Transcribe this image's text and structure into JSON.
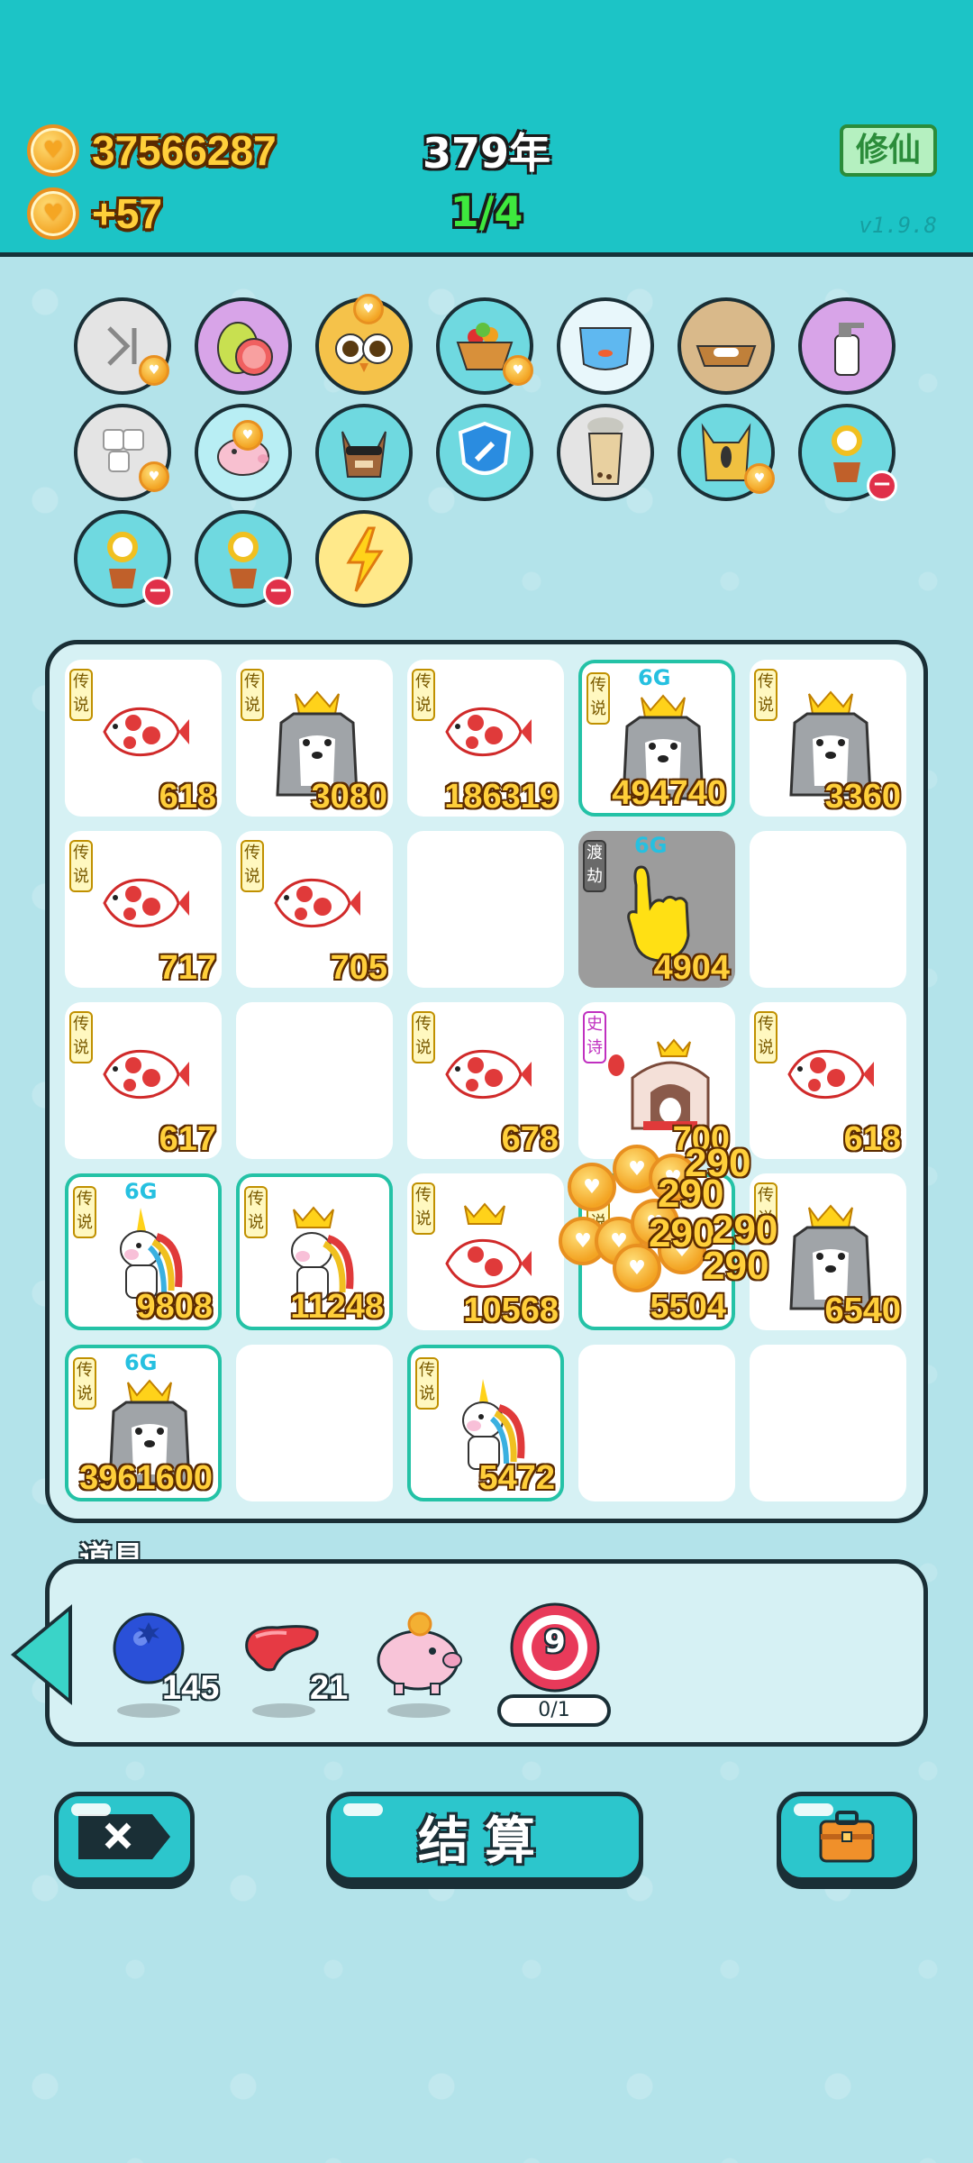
{
  "header": {
    "coins": "37566287",
    "income": "+57",
    "year": "379年",
    "round": "1/4",
    "cultivate_label": "修仙",
    "version": "v1.9.8"
  },
  "item_icons": [
    {
      "name": "skip-icon"
    },
    {
      "name": "pomelo-icon"
    },
    {
      "name": "owl-icon"
    },
    {
      "name": "fruit-basket-icon"
    },
    {
      "name": "fishbowl-icon"
    },
    {
      "name": "pet-food-icon"
    },
    {
      "name": "spray-bottle-icon"
    },
    {
      "name": "dice-icon"
    },
    {
      "name": "piggy-bank-icon"
    },
    {
      "name": "cool-dog-icon"
    },
    {
      "name": "shield-wrench-icon"
    },
    {
      "name": "bubble-tea-icon"
    },
    {
      "name": "cat-icon"
    },
    {
      "name": "flower-pot-icon"
    },
    {
      "name": "flower-pot-icon"
    },
    {
      "name": "flower-pot-icon"
    },
    {
      "name": "lightning-icon"
    }
  ],
  "grid": {
    "cells": [
      {
        "tag": "传说",
        "value": "618",
        "creature": "fish"
      },
      {
        "tag": "传说",
        "value": "3080",
        "creature": "husky-crown"
      },
      {
        "tag": "传说",
        "value": "186319",
        "creature": "fish"
      },
      {
        "tag": "传说",
        "badge": "6G",
        "value": "494740",
        "creature": "husky-crown"
      },
      {
        "tag": "传说",
        "value": "3360",
        "creature": "husky-crown"
      },
      {
        "tag": "传说",
        "value": "717",
        "creature": "fish"
      },
      {
        "tag": "传说",
        "value": "705",
        "creature": "fish"
      },
      {
        "tag": "",
        "value": "",
        "creature": "empty"
      },
      {
        "tag": "渡劫",
        "badge": "6G",
        "value": "4904",
        "creature": "hand"
      },
      {
        "tag": "",
        "value": "",
        "creature": "empty"
      },
      {
        "tag": "传说",
        "value": "617",
        "creature": "fish"
      },
      {
        "tag": "",
        "value": "",
        "creature": "empty"
      },
      {
        "tag": "传说",
        "value": "678",
        "creature": "fish"
      },
      {
        "tag": "史诗",
        "value": "700",
        "creature": "rabbit-house"
      },
      {
        "tag": "传说",
        "value": "618",
        "creature": "fish"
      },
      {
        "tag": "传说",
        "badge": "6G",
        "value": "9808",
        "creature": "unicorn"
      },
      {
        "tag": "传说",
        "value": "11248",
        "creature": "unicorn-crown"
      },
      {
        "tag": "传说",
        "value": "10568",
        "creature": "fish-crown"
      },
      {
        "tag": "传说",
        "value": "5504",
        "creature": "coins"
      },
      {
        "tag": "传说",
        "value": "6540",
        "creature": "husky-crown"
      },
      {
        "tag": "传说",
        "badge": "6G",
        "value": "3961600",
        "creature": "husky-crown"
      },
      {
        "tag": "",
        "value": "",
        "creature": "empty"
      },
      {
        "tag": "传说",
        "value": "5472",
        "creature": "unicorn"
      },
      {
        "tag": "",
        "value": "",
        "creature": "empty"
      },
      {
        "tag": "",
        "value": "",
        "creature": "empty"
      }
    ],
    "burst_numbers": [
      "290",
      "290",
      "290",
      "290",
      "290"
    ]
  },
  "props": {
    "label": "道具",
    "items": [
      {
        "name": "blueberry",
        "count": "145"
      },
      {
        "name": "liver",
        "count": "21"
      },
      {
        "name": "piggy-bank",
        "count": ""
      },
      {
        "name": "target",
        "number": "9",
        "progress": "0/1"
      }
    ]
  },
  "buttons": {
    "settle_label": "结算"
  },
  "colors": {
    "header_bg": "#1cc4c6",
    "page_bg": "#b3e3ea",
    "coin_text": "#ffcf3a",
    "round_text": "#3ee83e",
    "legend_tag": "#fff8c0",
    "teal_border": "#24c2a6"
  }
}
